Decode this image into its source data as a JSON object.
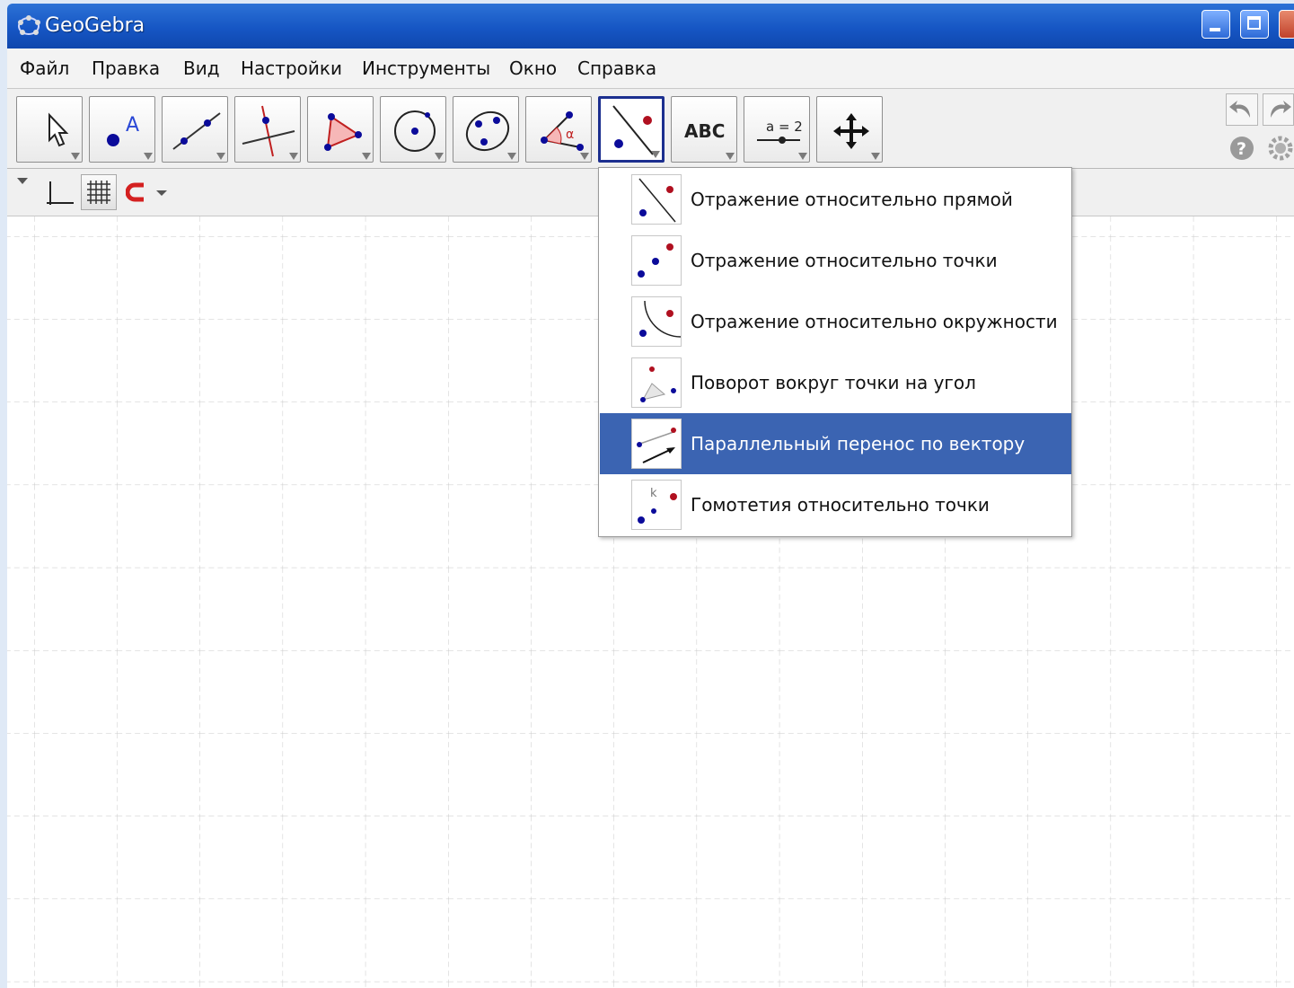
{
  "window": {
    "title": "GeoGebra"
  },
  "menu": [
    "Файл",
    "Правка",
    "Вид",
    "Настройки",
    "Инструменты",
    "Окно",
    "Справка"
  ],
  "toolbar": {
    "tools": [
      {
        "icon": "move-arrow-icon"
      },
      {
        "icon": "point-icon",
        "text": "A"
      },
      {
        "icon": "line-through-two-points-icon"
      },
      {
        "icon": "perpendicular-line-icon"
      },
      {
        "icon": "polygon-icon"
      },
      {
        "icon": "circle-center-point-icon"
      },
      {
        "icon": "conic-five-points-icon"
      },
      {
        "icon": "angle-icon",
        "text": "α"
      },
      {
        "icon": "reflect-about-line-icon",
        "active": true
      },
      {
        "icon": "text-icon",
        "text": "ABC"
      },
      {
        "icon": "slider-icon",
        "text": "a = 2"
      },
      {
        "icon": "move-graphics-view-icon"
      }
    ]
  },
  "transform_menu": {
    "items": [
      {
        "label": "Отражение относительно прямой",
        "icon": "reflect-line-icon",
        "selected": false
      },
      {
        "label": "Отражение относительно точки",
        "icon": "reflect-point-icon",
        "selected": false
      },
      {
        "label": "Отражение относительно окружности",
        "icon": "reflect-circle-icon",
        "selected": false
      },
      {
        "label": "Поворот вокруг точки на угол",
        "icon": "rotate-icon",
        "selected": false
      },
      {
        "label": "Параллельный перенос по вектору",
        "icon": "translate-vector-icon",
        "selected": true
      },
      {
        "label": "Гомотетия относительно точки",
        "icon": "dilate-icon",
        "selected": false,
        "k_label": "k"
      }
    ]
  },
  "colors": {
    "titlebar": "#1656c4",
    "selection": "#3b64b2",
    "point_blue": "#1010a8",
    "point_red": "#b01020",
    "grid": "#c8c8c8"
  }
}
